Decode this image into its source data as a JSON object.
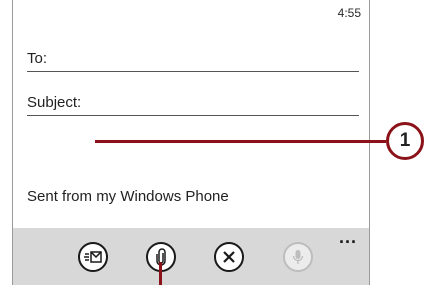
{
  "status_bar": {
    "time": "4:55"
  },
  "compose": {
    "to_label": "To:",
    "subject_label": "Subject:",
    "signature": "Sent from my Windows Phone"
  },
  "app_bar": {
    "buttons": [
      {
        "name": "send",
        "icon": "send-email-icon",
        "enabled": true
      },
      {
        "name": "attach",
        "icon": "paperclip-icon",
        "enabled": true
      },
      {
        "name": "discard",
        "icon": "close-x-icon",
        "enabled": true
      },
      {
        "name": "dictate",
        "icon": "microphone-icon",
        "enabled": false
      }
    ],
    "more_label": "..."
  },
  "callouts": [
    {
      "label": "1"
    }
  ],
  "colors": {
    "callout": "#8b1219",
    "app_bar": "#d8d8d8"
  }
}
